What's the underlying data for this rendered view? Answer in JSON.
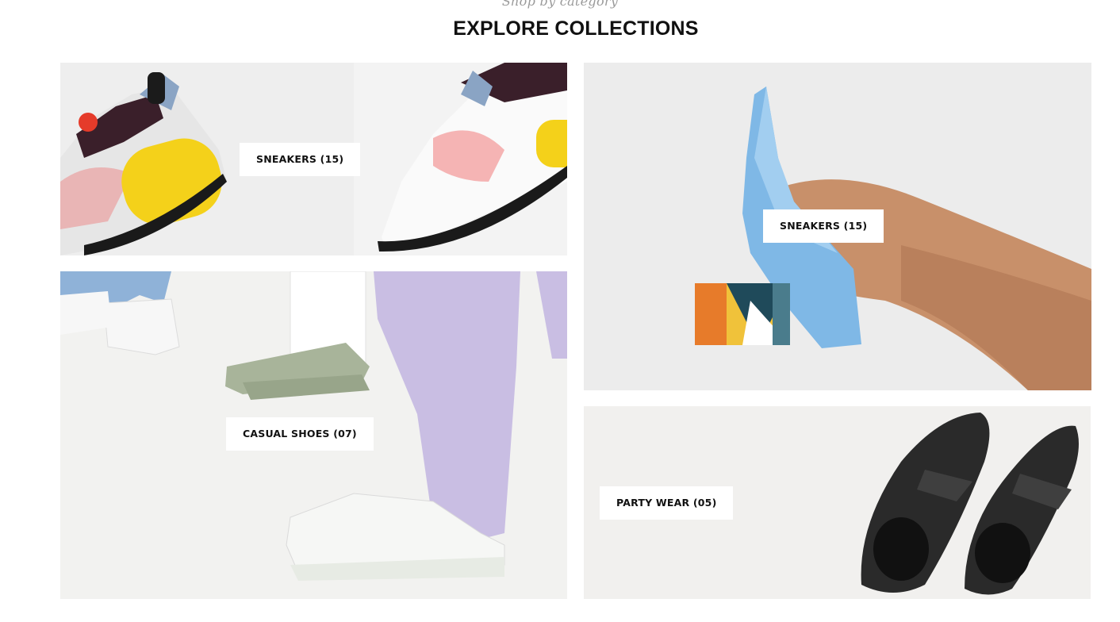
{
  "section": {
    "eyebrow": "Shop by category",
    "title": "EXPLORE COLLECTIONS"
  },
  "collections": [
    {
      "label": "SNEAKERS (15)",
      "image": "sneakers-image"
    },
    {
      "label": "CASUAL SHOES (07)",
      "image": "casual-shoes-image"
    },
    {
      "label": "SNEAKERS (15)",
      "image": "heels-image"
    },
    {
      "label": "PARTY WEAR (05)",
      "image": "loafers-image"
    }
  ]
}
